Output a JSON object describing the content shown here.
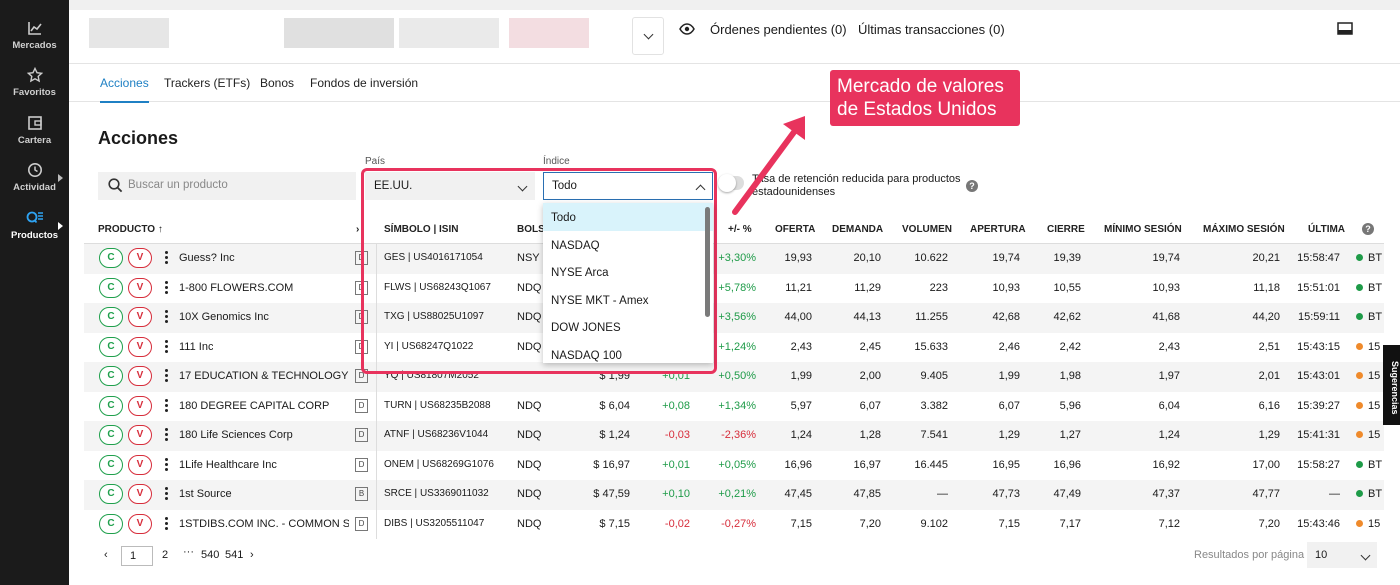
{
  "sidebar": {
    "items": [
      {
        "label": "Mercados",
        "icon": "chart-line-icon"
      },
      {
        "label": "Favoritos",
        "icon": "star-icon"
      },
      {
        "label": "Cartera",
        "icon": "wallet-icon"
      },
      {
        "label": "Actividad",
        "icon": "clock-icon"
      },
      {
        "label": "Productos",
        "icon": "products-icon"
      }
    ]
  },
  "header": {
    "pending_orders": "Órdenes pendientes (0)",
    "last_transactions": "Últimas transacciones (0)"
  },
  "tabs": [
    "Acciones",
    "Trackers (ETFs)",
    "Bonos",
    "Fondos de inversión"
  ],
  "page_title": "Acciones",
  "filters": {
    "search_placeholder": "Buscar un producto",
    "country_label": "País",
    "country_value": "EE.UU.",
    "index_label": "Índice",
    "index_value": "Todo",
    "tax_toggle_label": "Tasa de retención reducida para productos estadounidenses",
    "index_options": [
      "Todo",
      "NASDAQ",
      "NYSE Arca",
      "NYSE MKT - Amex",
      "DOW JONES",
      "NASDAQ 100"
    ]
  },
  "callout": {
    "line1": "Mercado de valores",
    "line2": "de Estados Unidos"
  },
  "table": {
    "headers": {
      "product": "PRODUCTO ↑",
      "symbol": "SÍMBOLO | ISIN",
      "exchange": "BOLSA",
      "change_pct": "+/- %",
      "bid": "OFERTA",
      "ask": "DEMANDA",
      "volume": "VOLUMEN",
      "open": "APERTURA",
      "close": "CIERRE",
      "low": "MÍNIMO SESIÓN",
      "high": "MÁXIMO SESIÓN",
      "last": "ÚLTIMA"
    },
    "buy_label": "C",
    "sell_label": "V",
    "rows": [
      {
        "name": "Guess? Inc",
        "type": "D",
        "symbol": "GES | US4016171054",
        "exchange": "NSY",
        "price": "",
        "change": "",
        "change_pct": "+3,30%",
        "bid": "19,93",
        "ask": "20,10",
        "volume": "10.622",
        "open": "19,74",
        "close": "19,39",
        "low": "19,74",
        "high": "20,21",
        "time": "15:58:47",
        "feed": "BT",
        "feed_color": "#1e9b48"
      },
      {
        "name": "1-800 FLOWERS.COM",
        "type": "D",
        "symbol": "FLWS | US68243Q1067",
        "exchange": "NDQ",
        "price": "",
        "change": "",
        "change_pct": "+5,78%",
        "bid": "11,21",
        "ask": "11,29",
        "volume": "223",
        "open": "10,93",
        "close": "10,55",
        "low": "10,93",
        "high": "11,18",
        "time": "15:51:01",
        "feed": "BT",
        "feed_color": "#1e9b48"
      },
      {
        "name": "10X Genomics Inc",
        "type": "D",
        "symbol": "TXG | US88025U1097",
        "exchange": "NDQ",
        "price": "",
        "change": "",
        "change_pct": "+3,56%",
        "bid": "44,00",
        "ask": "44,13",
        "volume": "11.255",
        "open": "42,68",
        "close": "42,62",
        "low": "41,68",
        "high": "44,20",
        "time": "15:59:11",
        "feed": "BT",
        "feed_color": "#1e9b48"
      },
      {
        "name": "111 Inc",
        "type": "D",
        "symbol": "YI | US68247Q1022",
        "exchange": "NDQ",
        "price": "",
        "change": "",
        "change_pct": "+1,24%",
        "bid": "2,43",
        "ask": "2,45",
        "volume": "15.633",
        "open": "2,46",
        "close": "2,42",
        "low": "2,43",
        "high": "2,51",
        "time": "15:43:15",
        "feed": "15",
        "feed_color": "#ef8a2b"
      },
      {
        "name": "17 EDUCATION & TECHNOLOGY ...",
        "type": "D",
        "symbol": "YQ | US81807M2052",
        "exchange": "",
        "price": "$ 1,99",
        "change": "+0,01",
        "change_pct": "+0,50%",
        "bid": "1,99",
        "ask": "2,00",
        "volume": "9.405",
        "open": "1,99",
        "close": "1,98",
        "low": "1,97",
        "high": "2,01",
        "time": "15:43:01",
        "feed": "15",
        "feed_color": "#ef8a2b"
      },
      {
        "name": "180 DEGREE CAPITAL CORP",
        "type": "D",
        "symbol": "TURN | US68235B2088",
        "exchange": "NDQ",
        "price": "$ 6,04",
        "change": "+0,08",
        "change_pct": "+1,34%",
        "bid": "5,97",
        "ask": "6,07",
        "volume": "3.382",
        "open": "6,07",
        "close": "5,96",
        "low": "6,04",
        "high": "6,16",
        "time": "15:39:27",
        "feed": "15",
        "feed_color": "#ef8a2b"
      },
      {
        "name": "180 Life Sciences Corp",
        "type": "D",
        "symbol": "ATNF | US68236V1044",
        "exchange": "NDQ",
        "price": "$ 1,24",
        "change": "-0,03",
        "change_pct": "-2,36%",
        "bid": "1,24",
        "ask": "1,28",
        "volume": "7.541",
        "open": "1,29",
        "close": "1,27",
        "low": "1,24",
        "high": "1,29",
        "time": "15:41:31",
        "feed": "15",
        "feed_color": "#ef8a2b"
      },
      {
        "name": "1Life Healthcare Inc",
        "type": "D",
        "symbol": "ONEM | US68269G1076",
        "exchange": "NDQ",
        "price": "$ 16,97",
        "change": "+0,01",
        "change_pct": "+0,05%",
        "bid": "16,96",
        "ask": "16,97",
        "volume": "16.445",
        "open": "16,95",
        "close": "16,96",
        "low": "16,92",
        "high": "17,00",
        "time": "15:58:27",
        "feed": "BT",
        "feed_color": "#1e9b48"
      },
      {
        "name": "1st Source",
        "type": "B",
        "symbol": "SRCE | US3369011032",
        "exchange": "NDQ",
        "price": "$ 47,59",
        "change": "+0,10",
        "change_pct": "+0,21%",
        "bid": "47,45",
        "ask": "47,85",
        "volume": "—",
        "open": "47,73",
        "close": "47,49",
        "low": "47,37",
        "high": "47,77",
        "time": "—",
        "feed": "BT",
        "feed_color": "#1e9b48"
      },
      {
        "name": "1STDIBS.COM INC. - COMMON S...",
        "type": "D",
        "symbol": "DIBS | US3205511047",
        "exchange": "NDQ",
        "price": "$ 7,15",
        "change": "-0,02",
        "change_pct": "-0,27%",
        "bid": "7,15",
        "ask": "7,20",
        "volume": "9.102",
        "open": "7,15",
        "close": "7,17",
        "low": "7,12",
        "high": "7,20",
        "time": "15:43:46",
        "feed": "15",
        "feed_color": "#ef8a2b"
      }
    ]
  },
  "pagination": {
    "current": "1",
    "next": "2",
    "ellipsis": "···",
    "p540": "540",
    "p541": "541",
    "per_page_label": "Resultados por página",
    "per_page_value": "10"
  },
  "suggestions": "Sugerencias"
}
